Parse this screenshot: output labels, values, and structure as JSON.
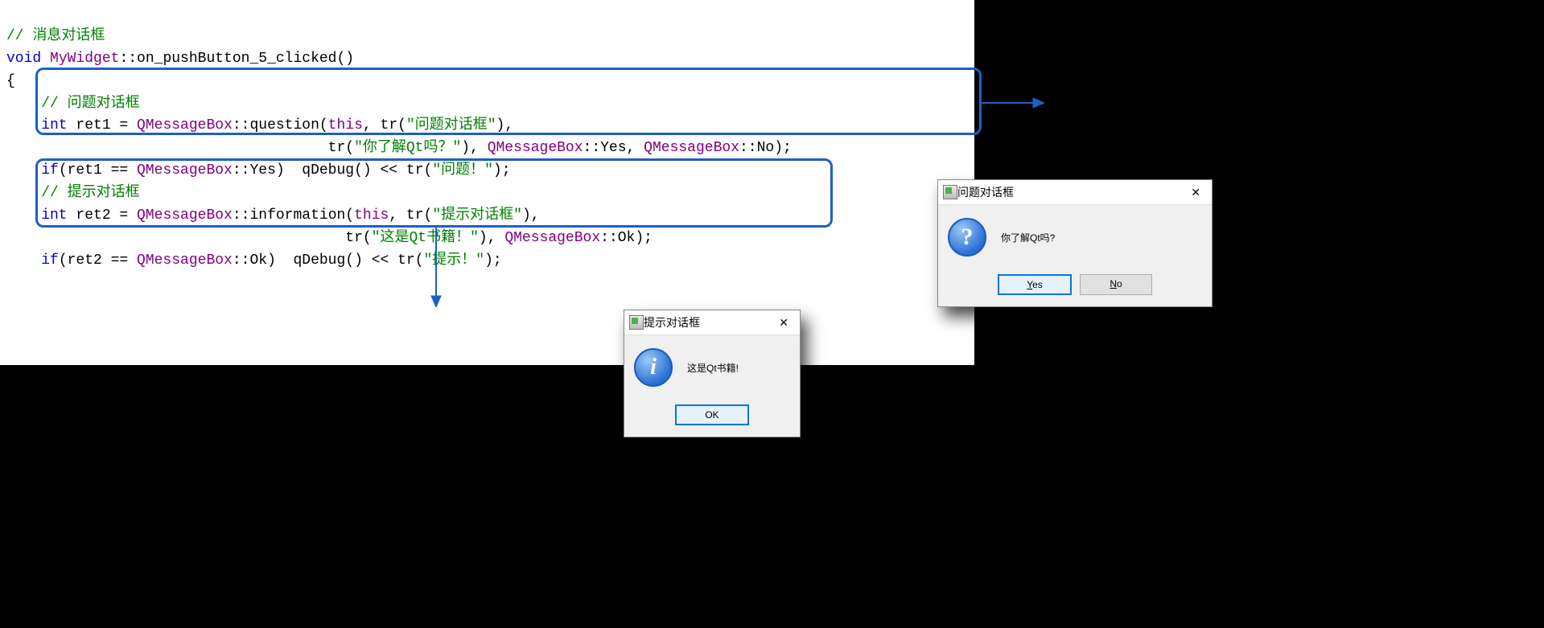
{
  "code": {
    "comment_msgbox": "// 消息对话框",
    "line_sig_1": "void",
    "line_sig_2": " MyWidget",
    "line_sig_3": "::on_pushButton_5_clicked()",
    "brace_open": "{",
    "comment_q": "    // 问题对话框",
    "q_line1_a": "    int",
    "q_line1_b": " ret1 = ",
    "q_line1_c": "QMessageBox",
    "q_line1_d": "::question(",
    "q_line1_e": "this",
    "q_line1_f": ", tr(",
    "q_line1_g": "\"问题对话框\"",
    "q_line1_h": "),",
    "q_line2_a": "                                     tr(",
    "q_line2_b": "\"你了解Qt吗？\"",
    "q_line2_c": "), ",
    "q_line2_d": "QMessageBox",
    "q_line2_e": "::Yes, ",
    "q_line2_f": "QMessageBox",
    "q_line2_g": "::No);",
    "if1_a": "    if",
    "if1_b": "(ret1 == ",
    "if1_c": "QMessageBox",
    "if1_d": "::Yes)  qDebug() << tr(",
    "if1_e": "\"问题！\"",
    "if1_f": ");",
    "comment_i": "    // 提示对话框",
    "i_line1_a": "    int",
    "i_line1_b": " ret2 = ",
    "i_line1_c": "QMessageBox",
    "i_line1_d": "::information(",
    "i_line1_e": "this",
    "i_line1_f": ", tr(",
    "i_line1_g": "\"提示对话框\"",
    "i_line1_h": "),",
    "i_line2_a": "                                       tr(",
    "i_line2_b": "\"这是Qt书籍！\"",
    "i_line2_c": "), ",
    "i_line2_d": "QMessageBox",
    "i_line2_e": "::Ok);",
    "if2_a": "    if",
    "if2_b": "(ret2 == ",
    "if2_c": "QMessageBox",
    "if2_d": "::Ok)  qDebug() << tr(",
    "if2_e": "\"提示！\"",
    "if2_f": ");"
  },
  "dialog_question": {
    "title": "问题对话框",
    "message": "你了解Qt吗?",
    "yes_prefix": "Y",
    "yes_rest": "es",
    "no_prefix": "N",
    "no_rest": "o"
  },
  "dialog_info": {
    "title": "提示对话框",
    "message": "这是Qt书籍!",
    "ok": "OK"
  }
}
